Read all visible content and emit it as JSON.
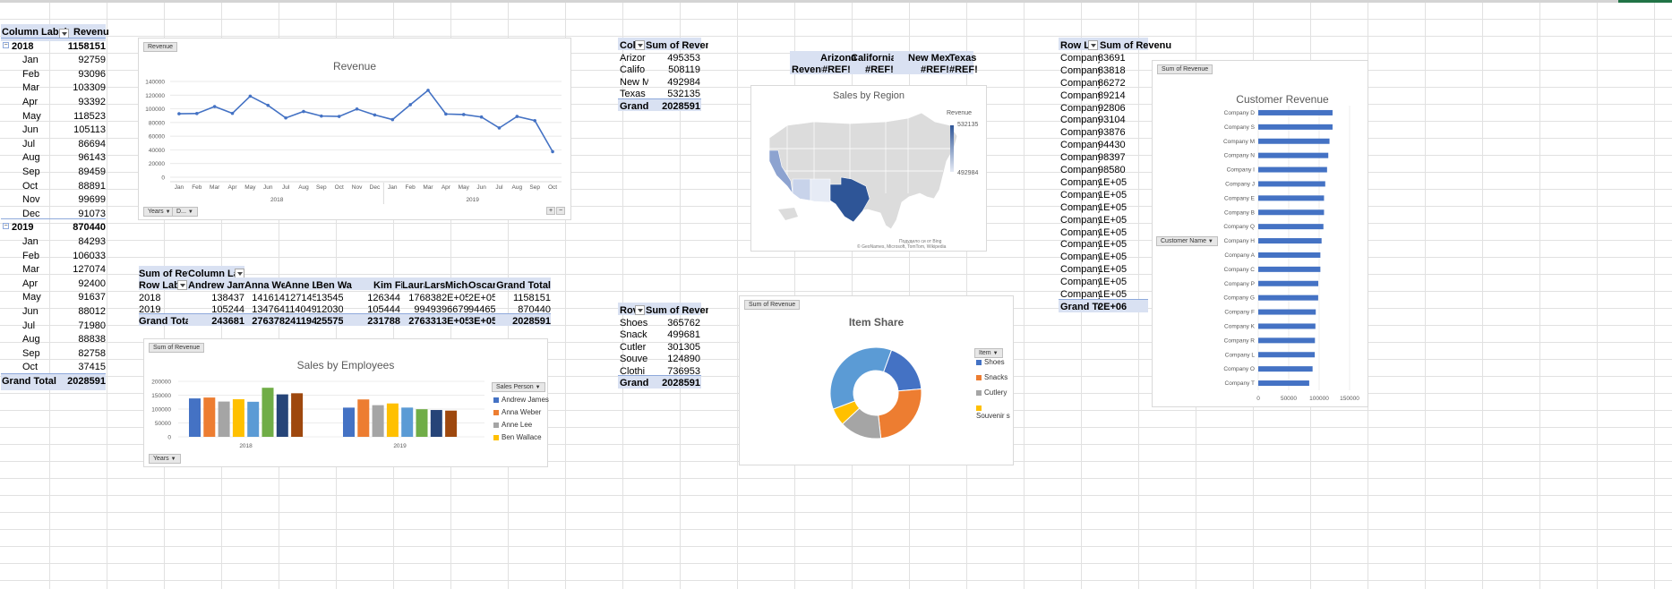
{
  "pivot1": {
    "header": [
      "Column Labels",
      "Revenue"
    ],
    "years": [
      {
        "label": "2018",
        "total": "1158151",
        "months": [
          [
            "Jan",
            "92759"
          ],
          [
            "Feb",
            "93096"
          ],
          [
            "Mar",
            "103309"
          ],
          [
            "Apr",
            "93392"
          ],
          [
            "May",
            "118523"
          ],
          [
            "Jun",
            "105113"
          ],
          [
            "Jul",
            "86694"
          ],
          [
            "Aug",
            "96143"
          ],
          [
            "Sep",
            "89459"
          ],
          [
            "Oct",
            "88891"
          ],
          [
            "Nov",
            "99699"
          ],
          [
            "Dec",
            "91073"
          ]
        ]
      },
      {
        "label": "2019",
        "total": "870440",
        "months": [
          [
            "Jan",
            "84293"
          ],
          [
            "Feb",
            "106033"
          ],
          [
            "Mar",
            "127074"
          ],
          [
            "Apr",
            "92400"
          ],
          [
            "May",
            "91637"
          ],
          [
            "Jun",
            "88012"
          ],
          [
            "Jul",
            "71980"
          ],
          [
            "Aug",
            "88838"
          ],
          [
            "Sep",
            "82758"
          ],
          [
            "Oct",
            "37415"
          ]
        ]
      }
    ],
    "grand_total_label": "Grand Total",
    "grand_total": "2028591"
  },
  "revenue_chart": {
    "field_button": "Revenue",
    "title": "Revenue",
    "bottom_buttons": [
      "Years",
      "D..."
    ],
    "zoom_buttons": [
      "+",
      "−"
    ],
    "year_labels": [
      "2018",
      "2019"
    ],
    "chart_data": {
      "type": "line",
      "categories": [
        "Jan",
        "Feb",
        "Mar",
        "Apr",
        "May",
        "Jun",
        "Jul",
        "Aug",
        "Sep",
        "Oct",
        "Nov",
        "Dec",
        "Jan",
        "Feb",
        "Mar",
        "Apr",
        "May",
        "Jun",
        "Jul",
        "Aug",
        "Sep",
        "Oct"
      ],
      "values": [
        92759,
        93096,
        103309,
        93392,
        118523,
        105113,
        86694,
        96143,
        89459,
        88891,
        99699,
        91073,
        84293,
        106033,
        127074,
        92400,
        91637,
        88012,
        71980,
        88838,
        82758,
        37415
      ],
      "yticks": [
        "0",
        "20000",
        "40000",
        "60000",
        "80000",
        "100000",
        "120000",
        "140000"
      ],
      "ylim": [
        0,
        140000
      ],
      "color": "#4472c4"
    }
  },
  "emp_table": {
    "row1": [
      "Sum of Reve",
      "Column Lab"
    ],
    "header": [
      "Row Labe",
      "Andrew James",
      "Anna Web",
      "Anne Le",
      "Ben Wa",
      "Kim Fishman",
      "Laura La",
      "Lars",
      "Michae",
      "Oscar",
      "Grand Total"
    ],
    "rows": [
      [
        "2018",
        "138437",
        "141614",
        "127145",
        "135455",
        "126344",
        "176838",
        "2E+05",
        "2E+05",
        "1158151"
      ],
      [
        "2019",
        "105244",
        "134764",
        "114049",
        "120302",
        "105444",
        "99493",
        "96679",
        "94465",
        "870440"
      ]
    ],
    "total": [
      "Grand Total",
      "243681",
      "276378",
      "241194",
      "255757",
      "231788",
      "276331",
      "3E+05",
      "3E+05",
      "2028591"
    ]
  },
  "emp_chart": {
    "field_button": "Sum of Revenue",
    "title": "Sales by Employees",
    "legend_button": "Sales Person",
    "bottom_button": "Years",
    "legend": [
      "Andrew James",
      "Anna Weber",
      "Anne Lee",
      "Ben Wallace"
    ],
    "chart_data": {
      "type": "bar",
      "categories": [
        "2018",
        "2019"
      ],
      "series_colors": [
        "#4472c4",
        "#ed7d31",
        "#a5a5a5",
        "#ffc000",
        "#5b9bd5",
        "#70ad47",
        "#264478",
        "#9e480e"
      ],
      "values_2018": [
        138437,
        141614,
        127145,
        135455,
        126344,
        176838,
        153000,
        157000
      ],
      "values_2019": [
        105244,
        134764,
        114049,
        120302,
        105444,
        99493,
        96679,
        94465
      ],
      "yticks": [
        "0",
        "50000",
        "100000",
        "150000",
        "200000"
      ],
      "ylim": [
        0,
        200000
      ]
    }
  },
  "region_table": {
    "header": [
      "Col",
      "Sum of Revenue"
    ],
    "rows": [
      [
        "Arizor",
        "495353"
      ],
      [
        "Califo",
        "508119"
      ],
      [
        "New M",
        "492984"
      ],
      [
        "Texas",
        "532135"
      ]
    ],
    "total": [
      "Grand",
      "2028591"
    ]
  },
  "ref_table": {
    "header": [
      "Arizona",
      "California",
      "New Mexi",
      "Texas"
    ],
    "row_label": "Revenu",
    "values": [
      "#REF!",
      "#REF!",
      "#REF!",
      "#REF!"
    ]
  },
  "map_chart": {
    "title": "Sales by Region",
    "legend_title": "Revenue",
    "legend_max": "532135",
    "legend_min": "492984",
    "credit1": "Подудило си от Bing",
    "credit2": "© GeoNames, Microsoft, TomTom, Wikipedia"
  },
  "item_table": {
    "header": [
      "Rov",
      "Sum of Revenue"
    ],
    "rows": [
      [
        "Shoes",
        "365762"
      ],
      [
        "Snack",
        "499681"
      ],
      [
        "Cutler",
        "301305"
      ],
      [
        "Souve",
        "124890"
      ],
      [
        "Clothi",
        "736953"
      ]
    ],
    "total": [
      "Grand",
      "2028591"
    ]
  },
  "item_chart": {
    "field_button": "Sum of Revenue",
    "title": "Item Share",
    "legend_button": "Item",
    "legend": [
      "Shoes",
      "Snacks",
      "Cutlery",
      "Souvenir s"
    ],
    "chart_data": {
      "type": "pie",
      "labels": [
        "Shoes",
        "Snacks",
        "Cutlery",
        "Souvenirs",
        "Clothing"
      ],
      "values": [
        365762,
        499681,
        301305,
        124890,
        736953
      ],
      "colors": [
        "#4472c4",
        "#ed7d31",
        "#a5a5a5",
        "#ffc000",
        "#5b9bd5"
      ]
    }
  },
  "cust_table": {
    "header": [
      "Row La",
      "Sum of Revenue"
    ],
    "rows": [
      [
        "Company",
        "83691"
      ],
      [
        "Company",
        "83818"
      ],
      [
        "Company",
        "86272"
      ],
      [
        "Company",
        "89214"
      ],
      [
        "Company",
        "92806"
      ],
      [
        "Company",
        "93104"
      ],
      [
        "Company",
        "93876"
      ],
      [
        "Company",
        "94430"
      ],
      [
        "Company",
        "98397"
      ],
      [
        "Company",
        "98580"
      ],
      [
        "Company",
        "1E+05"
      ],
      [
        "Company",
        "1E+05"
      ],
      [
        "Company",
        "1E+05"
      ],
      [
        "Company",
        "1E+05"
      ],
      [
        "Company",
        "1E+05"
      ],
      [
        "Company",
        "1E+05"
      ],
      [
        "Company",
        "1E+05"
      ],
      [
        "Company",
        "1E+05"
      ],
      [
        "Company",
        "1E+05"
      ],
      [
        "Company",
        "1E+05"
      ]
    ],
    "total": [
      "Grand Tot",
      "2E+06"
    ]
  },
  "cust_chart": {
    "field_button": "Sum of Revenue",
    "title": "Customer Revenue",
    "axis_button": "Customer Name",
    "chart_data": {
      "type": "bar",
      "categories": [
        "Company D",
        "Company S",
        "Company M",
        "Company N",
        "Company I",
        "Company J",
        "Company E",
        "Company B",
        "Company Q",
        "Company H",
        "Company A",
        "Company C",
        "Company P",
        "Company G",
        "Company F",
        "Company K",
        "Company R",
        "Company L",
        "Company O",
        "Company T"
      ],
      "values": [
        122000,
        122000,
        117000,
        115000,
        113000,
        110000,
        108000,
        108000,
        107000,
        104000,
        102000,
        102000,
        98580,
        98397,
        94430,
        93876,
        93104,
        92806,
        89214,
        83691
      ],
      "xticks": [
        "0",
        "50000",
        "100000",
        "150000"
      ],
      "xlim": [
        0,
        150000
      ],
      "color": "#4472c4"
    }
  }
}
